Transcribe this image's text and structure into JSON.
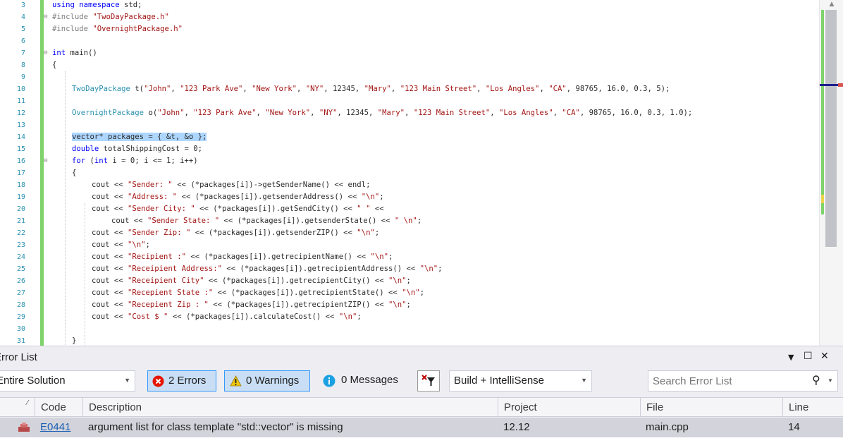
{
  "editor": {
    "lines": [
      {
        "n": "3",
        "indent": 0,
        "tokens": [
          [
            "kw",
            "using namespace"
          ],
          [
            "t",
            " std;"
          ]
        ]
      },
      {
        "n": "4",
        "indent": 0,
        "fold": "⊟",
        "tokens": [
          [
            "pp",
            "#include "
          ],
          [
            "str",
            "\"TwoDayPackage.h\""
          ]
        ]
      },
      {
        "n": "5",
        "indent": 0,
        "tokens": [
          [
            "pp",
            "#include "
          ],
          [
            "str",
            "\"OvernightPackage.h\""
          ]
        ]
      },
      {
        "n": "6",
        "indent": 0,
        "tokens": []
      },
      {
        "n": "7",
        "indent": 0,
        "fold": "⊟",
        "tokens": [
          [
            "kw",
            "int"
          ],
          [
            "t",
            " main()"
          ]
        ]
      },
      {
        "n": "8",
        "indent": 0,
        "tokens": [
          [
            "t",
            "{"
          ]
        ]
      },
      {
        "n": "9",
        "indent": 0,
        "tokens": []
      },
      {
        "n": "10",
        "indent": 1,
        "tokens": [
          [
            "ty",
            "TwoDayPackage"
          ],
          [
            "t",
            " t("
          ],
          [
            "str",
            "\"John\""
          ],
          [
            "t",
            ", "
          ],
          [
            "str",
            "\"123 Park Ave\""
          ],
          [
            "t",
            ", "
          ],
          [
            "str",
            "\"New York\""
          ],
          [
            "t",
            ", "
          ],
          [
            "str",
            "\"NY\""
          ],
          [
            "t",
            ", 12345, "
          ],
          [
            "str",
            "\"Mary\""
          ],
          [
            "t",
            ", "
          ],
          [
            "str",
            "\"123 Main Street\""
          ],
          [
            "t",
            ", "
          ],
          [
            "str",
            "\"Los Angles\""
          ],
          [
            "t",
            ", "
          ],
          [
            "str",
            "\"CA\""
          ],
          [
            "t",
            ", 98765, 16.0, 0.3, 5);"
          ]
        ]
      },
      {
        "n": "11",
        "indent": 0,
        "tokens": []
      },
      {
        "n": "12",
        "indent": 1,
        "tokens": [
          [
            "ty",
            "OvernightPackage"
          ],
          [
            "t",
            " o("
          ],
          [
            "str",
            "\"John\""
          ],
          [
            "t",
            ", "
          ],
          [
            "str",
            "\"123 Park Ave\""
          ],
          [
            "t",
            ", "
          ],
          [
            "str",
            "\"New York\""
          ],
          [
            "t",
            ", "
          ],
          [
            "str",
            "\"NY\""
          ],
          [
            "t",
            ", 12345, "
          ],
          [
            "str",
            "\"Mary\""
          ],
          [
            "t",
            ", "
          ],
          [
            "str",
            "\"123 Main Street\""
          ],
          [
            "t",
            ", "
          ],
          [
            "str",
            "\"Los Angles\""
          ],
          [
            "t",
            ", "
          ],
          [
            "str",
            "\"CA\""
          ],
          [
            "t",
            ", 98765, 16.0, 0.3, 1.0);"
          ]
        ]
      },
      {
        "n": "13",
        "indent": 0,
        "tokens": []
      },
      {
        "n": "14",
        "indent": 1,
        "tokens": [
          [
            "hl",
            "vector* packages = { &t, &o };"
          ]
        ]
      },
      {
        "n": "15",
        "indent": 1,
        "tokens": [
          [
            "kw",
            "double"
          ],
          [
            "t",
            " totalShippingCost = 0;"
          ]
        ]
      },
      {
        "n": "16",
        "indent": 1,
        "fold": "⊟",
        "tokens": [
          [
            "kw",
            "for"
          ],
          [
            "t",
            " ("
          ],
          [
            "kw",
            "int"
          ],
          [
            "t",
            " i = 0; i <= 1; i++)"
          ]
        ]
      },
      {
        "n": "17",
        "indent": 1,
        "tokens": [
          [
            "t",
            "{"
          ]
        ]
      },
      {
        "n": "18",
        "indent": 2,
        "tokens": [
          [
            "t",
            "cout << "
          ],
          [
            "str",
            "\"Sender: \""
          ],
          [
            "t",
            " << (*packages[i])->getSenderName() << endl;"
          ]
        ]
      },
      {
        "n": "19",
        "indent": 2,
        "tokens": [
          [
            "t",
            "cout << "
          ],
          [
            "str",
            "\"Address: \""
          ],
          [
            "t",
            " << (*packages[i]).getsenderAddress() << "
          ],
          [
            "str",
            "\"\\n\""
          ],
          [
            "t",
            ";"
          ]
        ]
      },
      {
        "n": "20",
        "indent": 2,
        "tokens": [
          [
            "t",
            "cout << "
          ],
          [
            "str",
            "\"Sender City: \""
          ],
          [
            "t",
            " << (*packages[i]).getSendCity() << "
          ],
          [
            "str",
            "\" \""
          ],
          [
            "t",
            " <<"
          ]
        ]
      },
      {
        "n": "21",
        "indent": 3,
        "tokens": [
          [
            "t",
            "cout << "
          ],
          [
            "str",
            "\"Sender State: \""
          ],
          [
            "t",
            " << (*packages[i]).getsenderState() << "
          ],
          [
            "str",
            "\" \\n\""
          ],
          [
            "t",
            ";"
          ]
        ]
      },
      {
        "n": "22",
        "indent": 2,
        "tokens": [
          [
            "t",
            "cout << "
          ],
          [
            "str",
            "\"Sender Zip: \""
          ],
          [
            "t",
            " << (*packages[i]).getsenderZIP() << "
          ],
          [
            "str",
            "\"\\n\""
          ],
          [
            "t",
            ";"
          ]
        ]
      },
      {
        "n": "23",
        "indent": 2,
        "tokens": [
          [
            "t",
            "cout << "
          ],
          [
            "str",
            "\"\\n\""
          ],
          [
            "t",
            ";"
          ]
        ]
      },
      {
        "n": "24",
        "indent": 2,
        "tokens": [
          [
            "t",
            "cout << "
          ],
          [
            "str",
            "\"Recipient :\""
          ],
          [
            "t",
            " << (*packages[i]).getrecipientName() << "
          ],
          [
            "str",
            "\"\\n\""
          ],
          [
            "t",
            ";"
          ]
        ]
      },
      {
        "n": "25",
        "indent": 2,
        "tokens": [
          [
            "t",
            "cout << "
          ],
          [
            "str",
            "\"Receipient Address:\""
          ],
          [
            "t",
            " << (*packages[i]).getrecipientAddress() << "
          ],
          [
            "str",
            "\"\\n\""
          ],
          [
            "t",
            ";"
          ]
        ]
      },
      {
        "n": "26",
        "indent": 2,
        "tokens": [
          [
            "t",
            "cout << "
          ],
          [
            "str",
            "\"Receipient City\""
          ],
          [
            "t",
            " << (*packages[i]).getrecipientCity() << "
          ],
          [
            "str",
            "\"\\n\""
          ],
          [
            "t",
            ";"
          ]
        ]
      },
      {
        "n": "27",
        "indent": 2,
        "tokens": [
          [
            "t",
            "cout << "
          ],
          [
            "str",
            "\"Recepient State :\""
          ],
          [
            "t",
            " << (*packages[i]).getrecipientState() << "
          ],
          [
            "str",
            "\"\\n\""
          ],
          [
            "t",
            ";"
          ]
        ]
      },
      {
        "n": "28",
        "indent": 2,
        "tokens": [
          [
            "t",
            "cout << "
          ],
          [
            "str",
            "\"Recepient Zip : \""
          ],
          [
            "t",
            " << (*packages[i]).getrecipientZIP() << "
          ],
          [
            "str",
            "\"\\n\""
          ],
          [
            "t",
            ";"
          ]
        ]
      },
      {
        "n": "29",
        "indent": 2,
        "tokens": [
          [
            "t",
            "cout << "
          ],
          [
            "str",
            "\"Cost $ \""
          ],
          [
            "t",
            " << (*packages[i]).calculateCost() << "
          ],
          [
            "str",
            "\"\\n\""
          ],
          [
            "t",
            ";"
          ]
        ]
      },
      {
        "n": "30",
        "indent": 0,
        "tokens": []
      },
      {
        "n": "31",
        "indent": 1,
        "tokens": [
          [
            "t",
            "}"
          ]
        ]
      }
    ]
  },
  "error_list": {
    "title": "Error List",
    "scope": "Entire Solution",
    "errors_label": "2 Errors",
    "warnings_label": "0 Warnings",
    "messages_label": "0 Messages",
    "filter_select": "Build + IntelliSense",
    "search_placeholder": "Search Error List",
    "columns": [
      "Code",
      "Description",
      "Project",
      "File",
      "Line"
    ],
    "rows": [
      {
        "code": "E0441",
        "description": "argument list for class template \"std::vector\" is missing",
        "project": "12.12",
        "file": "main.cpp",
        "line": "14"
      }
    ]
  },
  "colors": {
    "keyword": "#0000ff",
    "type": "#2b91af",
    "string": "#a31515",
    "preprocessor": "#808080",
    "selection": "#add6ff",
    "change_bar": "#7fd36b",
    "error": "#d9534f"
  }
}
